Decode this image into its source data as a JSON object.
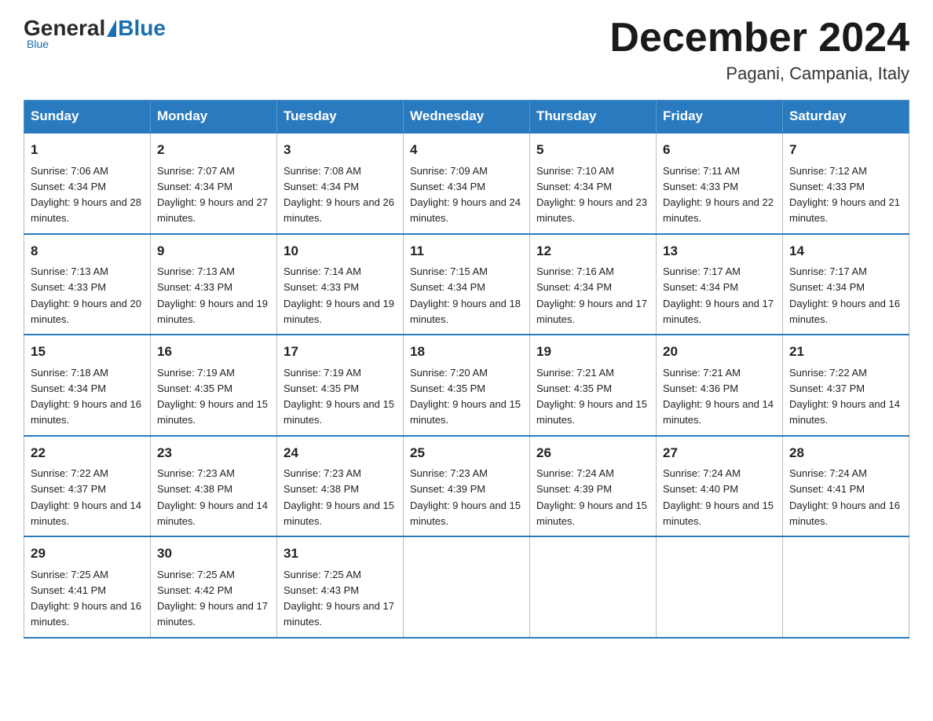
{
  "header": {
    "logo_general": "General",
    "logo_blue": "Blue",
    "month_title": "December 2024",
    "location": "Pagani, Campania, Italy"
  },
  "days_of_week": [
    "Sunday",
    "Monday",
    "Tuesday",
    "Wednesday",
    "Thursday",
    "Friday",
    "Saturday"
  ],
  "weeks": [
    [
      {
        "day": "1",
        "sunrise": "7:06 AM",
        "sunset": "4:34 PM",
        "daylight": "9 hours and 28 minutes."
      },
      {
        "day": "2",
        "sunrise": "7:07 AM",
        "sunset": "4:34 PM",
        "daylight": "9 hours and 27 minutes."
      },
      {
        "day": "3",
        "sunrise": "7:08 AM",
        "sunset": "4:34 PM",
        "daylight": "9 hours and 26 minutes."
      },
      {
        "day": "4",
        "sunrise": "7:09 AM",
        "sunset": "4:34 PM",
        "daylight": "9 hours and 24 minutes."
      },
      {
        "day": "5",
        "sunrise": "7:10 AM",
        "sunset": "4:34 PM",
        "daylight": "9 hours and 23 minutes."
      },
      {
        "day": "6",
        "sunrise": "7:11 AM",
        "sunset": "4:33 PM",
        "daylight": "9 hours and 22 minutes."
      },
      {
        "day": "7",
        "sunrise": "7:12 AM",
        "sunset": "4:33 PM",
        "daylight": "9 hours and 21 minutes."
      }
    ],
    [
      {
        "day": "8",
        "sunrise": "7:13 AM",
        "sunset": "4:33 PM",
        "daylight": "9 hours and 20 minutes."
      },
      {
        "day": "9",
        "sunrise": "7:13 AM",
        "sunset": "4:33 PM",
        "daylight": "9 hours and 19 minutes."
      },
      {
        "day": "10",
        "sunrise": "7:14 AM",
        "sunset": "4:33 PM",
        "daylight": "9 hours and 19 minutes."
      },
      {
        "day": "11",
        "sunrise": "7:15 AM",
        "sunset": "4:34 PM",
        "daylight": "9 hours and 18 minutes."
      },
      {
        "day": "12",
        "sunrise": "7:16 AM",
        "sunset": "4:34 PM",
        "daylight": "9 hours and 17 minutes."
      },
      {
        "day": "13",
        "sunrise": "7:17 AM",
        "sunset": "4:34 PM",
        "daylight": "9 hours and 17 minutes."
      },
      {
        "day": "14",
        "sunrise": "7:17 AM",
        "sunset": "4:34 PM",
        "daylight": "9 hours and 16 minutes."
      }
    ],
    [
      {
        "day": "15",
        "sunrise": "7:18 AM",
        "sunset": "4:34 PM",
        "daylight": "9 hours and 16 minutes."
      },
      {
        "day": "16",
        "sunrise": "7:19 AM",
        "sunset": "4:35 PM",
        "daylight": "9 hours and 15 minutes."
      },
      {
        "day": "17",
        "sunrise": "7:19 AM",
        "sunset": "4:35 PM",
        "daylight": "9 hours and 15 minutes."
      },
      {
        "day": "18",
        "sunrise": "7:20 AM",
        "sunset": "4:35 PM",
        "daylight": "9 hours and 15 minutes."
      },
      {
        "day": "19",
        "sunrise": "7:21 AM",
        "sunset": "4:35 PM",
        "daylight": "9 hours and 15 minutes."
      },
      {
        "day": "20",
        "sunrise": "7:21 AM",
        "sunset": "4:36 PM",
        "daylight": "9 hours and 14 minutes."
      },
      {
        "day": "21",
        "sunrise": "7:22 AM",
        "sunset": "4:37 PM",
        "daylight": "9 hours and 14 minutes."
      }
    ],
    [
      {
        "day": "22",
        "sunrise": "7:22 AM",
        "sunset": "4:37 PM",
        "daylight": "9 hours and 14 minutes."
      },
      {
        "day": "23",
        "sunrise": "7:23 AM",
        "sunset": "4:38 PM",
        "daylight": "9 hours and 14 minutes."
      },
      {
        "day": "24",
        "sunrise": "7:23 AM",
        "sunset": "4:38 PM",
        "daylight": "9 hours and 15 minutes."
      },
      {
        "day": "25",
        "sunrise": "7:23 AM",
        "sunset": "4:39 PM",
        "daylight": "9 hours and 15 minutes."
      },
      {
        "day": "26",
        "sunrise": "7:24 AM",
        "sunset": "4:39 PM",
        "daylight": "9 hours and 15 minutes."
      },
      {
        "day": "27",
        "sunrise": "7:24 AM",
        "sunset": "4:40 PM",
        "daylight": "9 hours and 15 minutes."
      },
      {
        "day": "28",
        "sunrise": "7:24 AM",
        "sunset": "4:41 PM",
        "daylight": "9 hours and 16 minutes."
      }
    ],
    [
      {
        "day": "29",
        "sunrise": "7:25 AM",
        "sunset": "4:41 PM",
        "daylight": "9 hours and 16 minutes."
      },
      {
        "day": "30",
        "sunrise": "7:25 AM",
        "sunset": "4:42 PM",
        "daylight": "9 hours and 17 minutes."
      },
      {
        "day": "31",
        "sunrise": "7:25 AM",
        "sunset": "4:43 PM",
        "daylight": "9 hours and 17 minutes."
      },
      null,
      null,
      null,
      null
    ]
  ]
}
